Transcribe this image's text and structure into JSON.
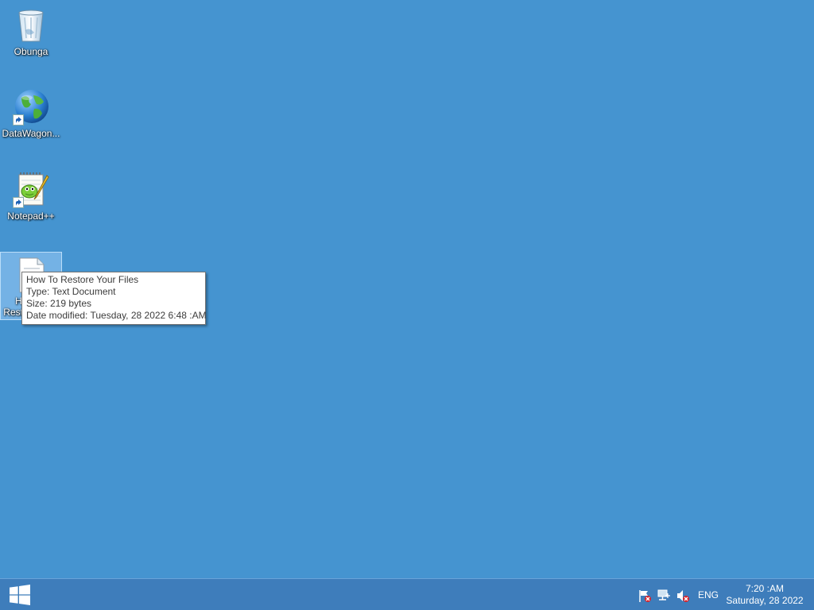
{
  "desktop": {
    "background_color": "#4594d0",
    "icons": [
      {
        "label": "Obunga",
        "icon": "recycle-bin-icon"
      },
      {
        "label": "DataWagon...",
        "icon": "globe-icon",
        "shortcut": true
      },
      {
        "label": "Notepad++",
        "icon": "notepad-plus-plus-icon",
        "shortcut": true
      },
      {
        "label": "How To Restore Your Files",
        "icon": "text-document-icon",
        "selected": true
      }
    ]
  },
  "tooltip": {
    "name": "How To Restore Your Files",
    "type": "Type: Text Document",
    "size": "Size: 219 bytes",
    "modified": "Date modified: Tuesday, 28 2022 6:48 :AM"
  },
  "taskbar": {
    "background_color": "#3e7dbb",
    "start_icon": "windows-logo-icon",
    "tray": {
      "icons": [
        "action-center-flag-icon",
        "network-icon",
        "volume-muted-icon"
      ],
      "language": "ENG",
      "time": "7:20 :AM",
      "date": "Saturday, 28 2022"
    }
  }
}
